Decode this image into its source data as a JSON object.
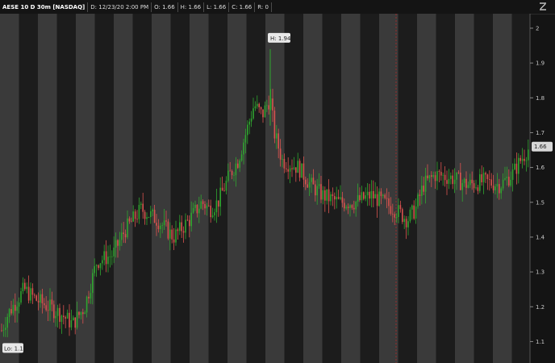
{
  "header": {
    "symbol": "AESE 10 D 30m [NASDAQ]",
    "date": "D: 12/23/20 2:00 PM",
    "open": "O: 1.66",
    "high": "H: 1.66",
    "low": "L: 1.66",
    "close": "C: 1.66",
    "range": "R: 0"
  },
  "chart_data": {
    "type": "candlestick",
    "ylim": [
      1.05,
      2.03
    ],
    "yticks": [
      "2",
      "1.9",
      "1.8",
      "1.7",
      "1.6",
      "1.5",
      "1.4",
      "1.3",
      "1.2",
      "1.1"
    ],
    "last_price_label": "1.66",
    "hi_label": "H: 1.94",
    "lo_label": "Lo: 1.1",
    "colors": {
      "up": "#2fa52f",
      "down": "#d9534f",
      "session_light": "#3a3a3a",
      "session_dark": "#1c1c1c",
      "last_price_bg": "#d8d8d8"
    }
  }
}
